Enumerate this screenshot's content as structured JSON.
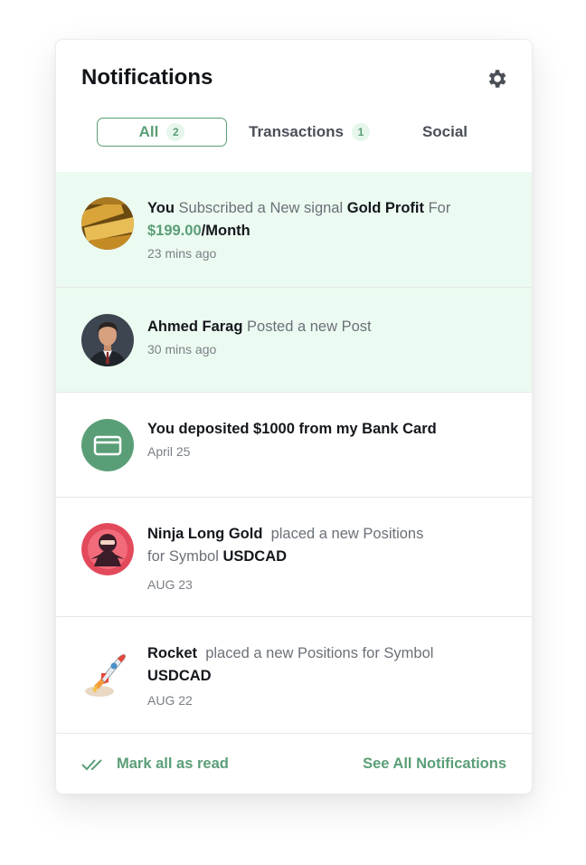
{
  "header": {
    "title": "Notifications",
    "settings_icon": "gear-icon"
  },
  "tabs": [
    {
      "label": "All",
      "count": "2",
      "active": true
    },
    {
      "label": "Transactions",
      "count": "1",
      "active": false
    },
    {
      "label": "Social",
      "count": "",
      "active": false
    }
  ],
  "notifications": [
    {
      "actor": "You",
      "text1": "Subscribed a New signal",
      "target": "Gold Profit",
      "text2": "For",
      "price": "$199.00",
      "period": "/Month",
      "time": "23 mins ago",
      "avatar": "gold-bars-avatar",
      "unread": true
    },
    {
      "actor": "Ahmed Farag",
      "text1": "Posted a new Post",
      "time": "30 mins ago",
      "avatar": "person-avatar",
      "unread": true
    },
    {
      "actor": "You deposited $1000 from my Bank Card",
      "time": "April 25",
      "avatar": "credit-card-icon",
      "unread": false
    },
    {
      "actor": "Ninja Long Gold",
      "text1": "placed a new Positions",
      "text2": "for Symbol",
      "target": "USDCAD",
      "time": "AUG 23",
      "avatar": "ninja-avatar",
      "unread": false
    },
    {
      "actor": "Rocket",
      "text1": "placed a new Positions for Symbol",
      "target": "USDCAD",
      "time": "AUG 22",
      "avatar": "rocket-avatar",
      "unread": false
    }
  ],
  "footer": {
    "mark_read_label": "Mark all as read",
    "see_all_label": "See All Notifications"
  },
  "colors": {
    "accent": "#5a9e77",
    "unread_bg": "#ecfbf1",
    "badge_bg": "#e7f6ec"
  }
}
